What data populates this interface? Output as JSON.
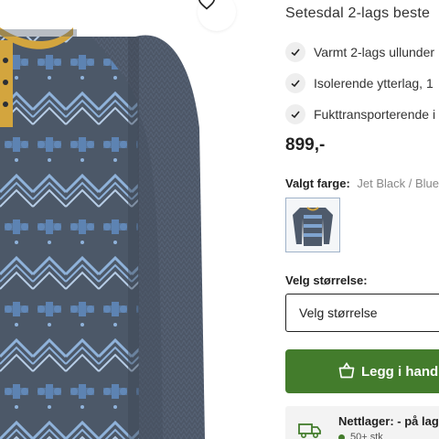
{
  "product": {
    "title": "Setesdal 2-lags beste",
    "price": "899,-",
    "features": [
      {
        "icon": "check-icon",
        "text": "Varmt 2-lags ullunder"
      },
      {
        "icon": "check-icon",
        "text": "Isolerende ytterlag, 1"
      },
      {
        "icon": "check-icon",
        "text": "Fukttransporterende i"
      }
    ]
  },
  "color": {
    "label": "Valgt farge:",
    "value": "Jet Black / Blue"
  },
  "size": {
    "label": "Velg størrelse:",
    "selected": "Velg størrelse"
  },
  "cart": {
    "label": "Legg i handle"
  },
  "stock": {
    "title": "Nettlager: - på lag",
    "detail": "50+ stk"
  },
  "colors": {
    "accent": "#437c2c",
    "garment_body": "#4e5a6b",
    "pattern": "#7fa3cf",
    "collar": "#d3a53e"
  },
  "icons": [
    "heart-icon",
    "check-icon",
    "shopping-bag-icon",
    "truck-icon"
  ]
}
